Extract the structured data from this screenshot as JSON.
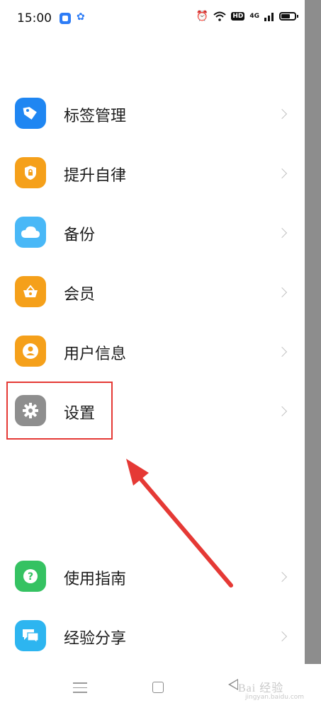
{
  "status_bar": {
    "time": "15:00",
    "network": "4G",
    "hd": "HD"
  },
  "menu": {
    "items": [
      {
        "label": "标签管理",
        "icon": "tag-icon"
      },
      {
        "label": "提升自律",
        "icon": "lock-shield-icon"
      },
      {
        "label": "备份",
        "icon": "cloud-icon"
      },
      {
        "label": "会员",
        "icon": "basket-icon"
      },
      {
        "label": "用户信息",
        "icon": "user-icon"
      },
      {
        "label": "设置",
        "icon": "gear-icon"
      }
    ],
    "bottom_items": [
      {
        "label": "使用指南",
        "icon": "help-icon"
      },
      {
        "label": "经验分享",
        "icon": "chat-icon"
      }
    ]
  },
  "watermark": {
    "text": "Bai 经验",
    "sub": "jingyan.baidu.com"
  },
  "colors": {
    "highlight": "#e53935",
    "tag": "#1f86f2",
    "orange": "#f5a01a",
    "cloud": "#49b8f7",
    "settings": "#8e8e8e",
    "help": "#35c262",
    "share": "#2db5f0"
  }
}
